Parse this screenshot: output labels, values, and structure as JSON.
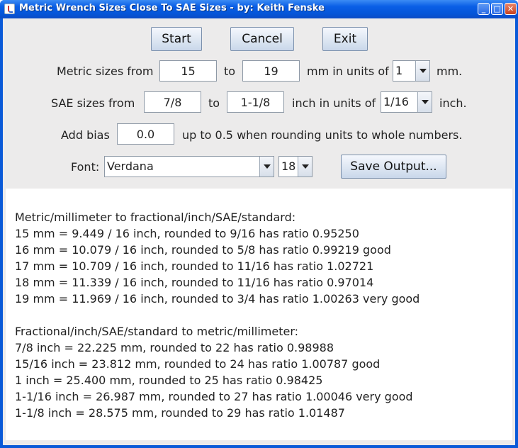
{
  "window": {
    "title": "Metric Wrench Sizes Close To SAE Sizes - by: Keith Fenske",
    "controls": {
      "minimize": "_",
      "maximize": "□",
      "close": "✕"
    }
  },
  "buttons": {
    "start": "Start",
    "cancel": "Cancel",
    "exit": "Exit",
    "save_output": "Save Output..."
  },
  "metric": {
    "label": "Metric sizes from",
    "from": "15",
    "to_label": "to",
    "to": "19",
    "units_label": "mm in units of",
    "unit": "1",
    "suffix": "mm."
  },
  "sae": {
    "label": "SAE sizes from",
    "from": "7/8",
    "to_label": "to",
    "to": "1-1/8",
    "units_label": "inch in units of",
    "unit": "1/16",
    "suffix": "inch."
  },
  "bias": {
    "label": "Add bias",
    "value": "0.0",
    "hint": "up to 0.5 when rounding units to whole numbers."
  },
  "font": {
    "label": "Font:",
    "name": "Verdana",
    "size": "18"
  },
  "output": {
    "lines": [
      "Metric/millimeter to fractional/inch/SAE/standard:",
      "15 mm = 9.449 / 16 inch, rounded to 9/16 has ratio 0.95250",
      "16 mm = 10.079 / 16 inch, rounded to 5/8 has ratio 0.99219 good",
      "17 mm = 10.709 / 16 inch, rounded to 11/16 has ratio 1.02721",
      "18 mm = 11.339 / 16 inch, rounded to 11/16 has ratio 0.97014",
      "19 mm = 11.969 / 16 inch, rounded to 3/4 has ratio 1.00263 very good",
      "",
      "Fractional/inch/SAE/standard to metric/millimeter:",
      "7/8 inch = 22.225 mm, rounded to 22 has ratio 0.98988",
      "15/16 inch = 23.812 mm, rounded to 24 has ratio 1.00787 good",
      "1 inch = 25.400 mm, rounded to 25 has ratio 0.98425",
      "1-1/16 inch = 26.987 mm, rounded to 27 has ratio 1.00046 very good",
      "1-1/8 inch = 28.575 mm, rounded to 29 has ratio 1.01487"
    ]
  }
}
